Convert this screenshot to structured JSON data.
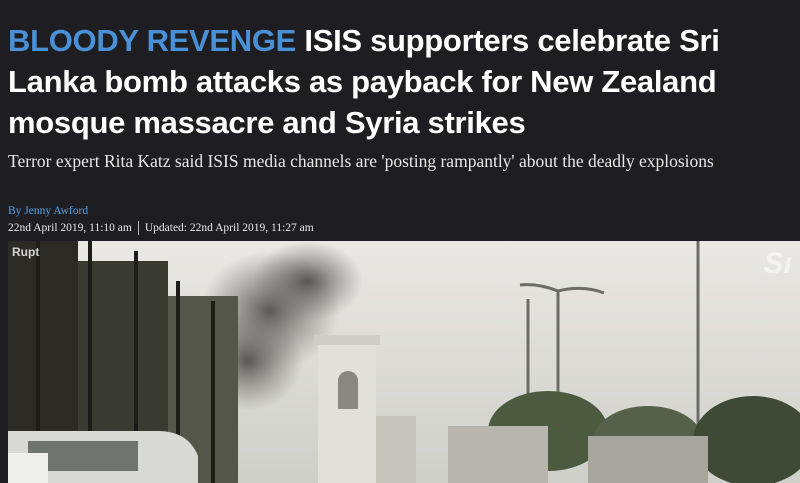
{
  "article": {
    "kicker": "BLOODY REVENGE",
    "headline": "ISIS supporters celebrate Sri Lanka bomb attacks as payback for New Zealand mosque massacre and Syria strikes",
    "standfirst": "Terror expert Rita Katz said ISIS media channels are 'posting rampantly' about the deadly explosions",
    "byline": "By Jenny Awford",
    "published": "22nd April 2019, 11:10 am",
    "updated": "Updated: 22nd April 2019, 11:27 am"
  },
  "video": {
    "watermark_left": "Rupt",
    "watermark_right": "Sı"
  },
  "colors": {
    "background": "#1e1e22",
    "kicker": "#4a90d6",
    "byline": "#5aa0e0",
    "text": "#ffffff"
  }
}
